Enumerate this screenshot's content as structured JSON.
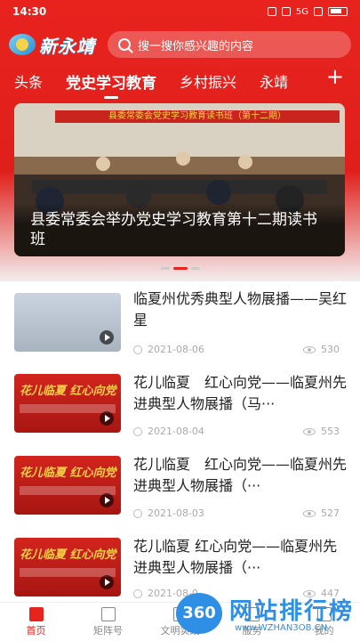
{
  "status_bar": {
    "time": "14:30",
    "battery": "5G"
  },
  "app": {
    "logo_text": "新永靖"
  },
  "search": {
    "placeholder": "搜一搜你感兴趣的内容"
  },
  "tabs": [
    {
      "label": "头条",
      "active": false
    },
    {
      "label": "党史学习教育",
      "active": true
    },
    {
      "label": "乡村振兴",
      "active": false
    },
    {
      "label": "永靖",
      "active": false
    }
  ],
  "tab_add": "+",
  "banner": {
    "sign": "县委常委会党史学习教育读书班（第十二期）",
    "caption": "县委常委会举办党史学习教育第十二期读书班"
  },
  "news": [
    {
      "title": "临夏州优秀典型人物展播——吴红星",
      "date": "2021-08-06",
      "views": "530",
      "thumb_text": ""
    },
    {
      "title": "花儿临夏　红心向党——临夏州先进典型人物展播（马···",
      "date": "2021-08-04",
      "views": "553",
      "thumb_text": "花儿临夏 红心向党"
    },
    {
      "title": "花儿临夏　红心向党——临夏州先进典型人物展播（···",
      "date": "2021-08-03",
      "views": "527",
      "thumb_text": "花儿临夏 红心向党"
    },
    {
      "title": "花儿临夏 红心向党——临夏州先进典型人物展播（···",
      "date": "2021-08-0",
      "views": "447",
      "thumb_text": "花儿临夏 红心向党"
    }
  ],
  "bottom_nav": [
    {
      "label": "首页",
      "active": true
    },
    {
      "label": "矩阵号",
      "active": false
    },
    {
      "label": "文明实践",
      "active": false
    },
    {
      "label": "服务",
      "active": false
    },
    {
      "label": "我的",
      "active": false
    }
  ],
  "watermark": {
    "badge": "360",
    "text": "网站排行榜",
    "url": "www.WZHAN3OB.CN"
  }
}
